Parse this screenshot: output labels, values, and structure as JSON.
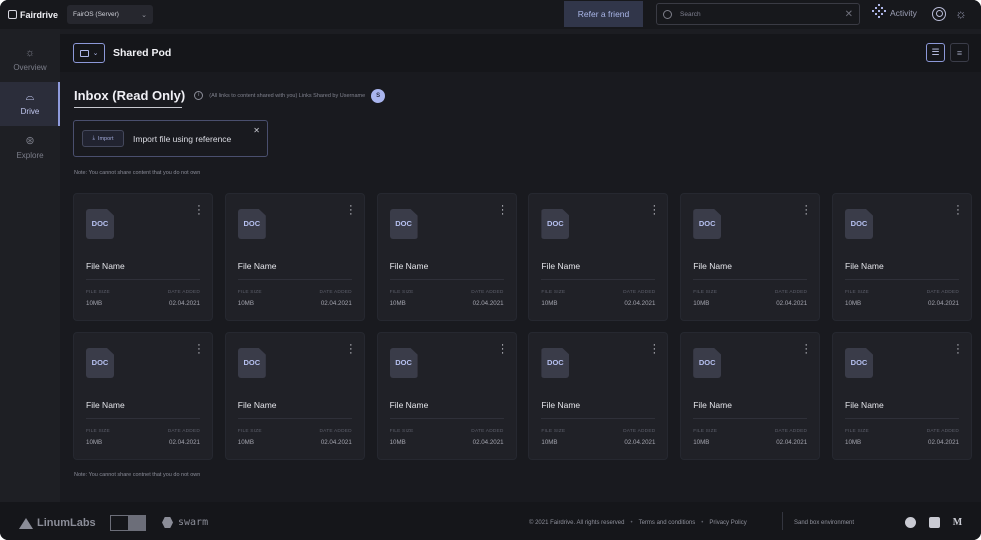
{
  "topbar": {
    "logo_text": "Fairdrive",
    "server_select": "FairOS (Server)",
    "refer_label": "Refer a friend",
    "search_placeholder": "Search",
    "activity_label": "Activity"
  },
  "sidenav": {
    "items": [
      {
        "label": "Overview",
        "icon": "sun-icon"
      },
      {
        "label": "Drive",
        "icon": "drive-icon"
      },
      {
        "label": "Explore",
        "icon": "compass-icon"
      }
    ]
  },
  "header": {
    "pod_title": "Shared Pod"
  },
  "inbox": {
    "title": "Inbox (Read Only)",
    "description": "(All links to content shared with you) Links Shared by Username",
    "avatar_initial": "S"
  },
  "import": {
    "button_label": "Import",
    "label": "Import file using reference"
  },
  "notes": {
    "top": "Note: You cannot share content that you do not own",
    "bottom": "Note: You cannot share contnet that you do not own"
  },
  "files": [
    {
      "type": "DOC",
      "name": "File Name",
      "size_label": "FILE SIZE",
      "size": "10MB",
      "date_label": "DATE ADDED",
      "date": "02.04.2021"
    },
    {
      "type": "DOC",
      "name": "File Name",
      "size_label": "FILE SIZE",
      "size": "10MB",
      "date_label": "DATE ADDED",
      "date": "02.04.2021"
    },
    {
      "type": "DOC",
      "name": "File Name",
      "size_label": "FILE SIZE",
      "size": "10MB",
      "date_label": "DATE ADDED",
      "date": "02.04.2021"
    },
    {
      "type": "DOC",
      "name": "File Name",
      "size_label": "FILE SIZE",
      "size": "10MB",
      "date_label": "DATE ADDED",
      "date": "02.04.2021"
    },
    {
      "type": "DOC",
      "name": "File Name",
      "size_label": "FILE SIZE",
      "size": "10MB",
      "date_label": "DATE ADDED",
      "date": "02.04.2021"
    },
    {
      "type": "DOC",
      "name": "File Name",
      "size_label": "FILE SIZE",
      "size": "10MB",
      "date_label": "DATE ADDED",
      "date": "02.04.2021"
    },
    {
      "type": "DOC",
      "name": "File Name",
      "size_label": "FILE SIZE",
      "size": "10MB",
      "date_label": "DATE ADDED",
      "date": "02.04.2021"
    },
    {
      "type": "DOC",
      "name": "File Name",
      "size_label": "FILE SIZE",
      "size": "10MB",
      "date_label": "DATE ADDED",
      "date": "02.04.2021"
    },
    {
      "type": "DOC",
      "name": "File Name",
      "size_label": "FILE SIZE",
      "size": "10MB",
      "date_label": "DATE ADDED",
      "date": "02.04.2021"
    },
    {
      "type": "DOC",
      "name": "File Name",
      "size_label": "FILE SIZE",
      "size": "10MB",
      "date_label": "DATE ADDED",
      "date": "02.04.2021"
    },
    {
      "type": "DOC",
      "name": "File Name",
      "size_label": "FILE SIZE",
      "size": "10MB",
      "date_label": "DATE ADDED",
      "date": "02.04.2021"
    },
    {
      "type": "DOC",
      "name": "File Name",
      "size_label": "FILE SIZE",
      "size": "10MB",
      "date_label": "DATE ADDED",
      "date": "02.04.2021"
    }
  ],
  "footer": {
    "brand": "LinumLabs",
    "swarm": "swarm",
    "copyright": "© 2021 Fairdrive. All rights reserved",
    "terms": "Terms and conditions",
    "privacy": "Privacy Policy",
    "sandbox": "Sand box environment",
    "medium_glyph": "M"
  },
  "colors": {
    "accent": "#8f9bdc",
    "background": "#191a1f",
    "card": "#202127"
  }
}
